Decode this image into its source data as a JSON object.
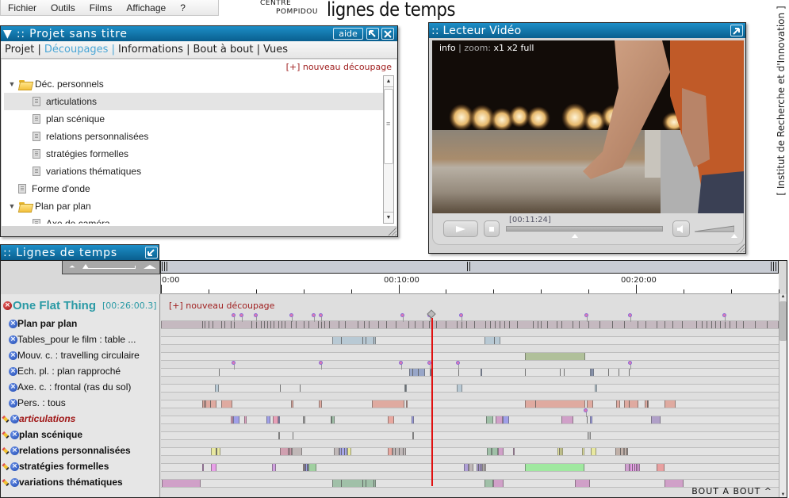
{
  "menu": [
    "Fichier",
    "Outils",
    "Films",
    "Affichage",
    "?"
  ],
  "logo": {
    "centre": "CENTRE",
    "pompidou": "POMPIDOU",
    "title": "lignes de temps"
  },
  "side_credit": "[ Institut de Recherche et d'Innovation ]",
  "project_panel": {
    "title": "▼ :: Projet sans titre",
    "help_label": "aide",
    "tabs": [
      {
        "label": "Projet |",
        "active": false
      },
      {
        "label": "Découpages |",
        "active": true
      },
      {
        "label": "Informations |",
        "active": false
      },
      {
        "label": "Bout à bout |",
        "active": false
      },
      {
        "label": "Vues",
        "active": false
      }
    ],
    "new_cut_label": "[+] nouveau découpage",
    "tree": [
      {
        "label": "Déc. personnels",
        "type": "folder",
        "level": 0,
        "expanded": true
      },
      {
        "label": "articulations",
        "type": "doc",
        "level": 1,
        "selected": true
      },
      {
        "label": "plan scénique",
        "type": "doc",
        "level": 1
      },
      {
        "label": "relations personnalisées",
        "type": "doc",
        "level": 1
      },
      {
        "label": "stratégies formelles",
        "type": "doc",
        "level": 1
      },
      {
        "label": "variations thématiques",
        "type": "doc",
        "level": 1
      },
      {
        "label": "Forme d'onde",
        "type": "doc",
        "level": 0.5
      },
      {
        "label": "Plan par plan",
        "type": "folder",
        "level": 0,
        "expanded": true
      },
      {
        "label": "Axe de caméra",
        "type": "doc",
        "level": 1
      }
    ]
  },
  "video_panel": {
    "title": ":: Lecteur Vidéo",
    "overlay": {
      "info": "info",
      "sep": " | ",
      "zoom": "zoom: ",
      "x1": "x1",
      "x2": "x2",
      "full": "full"
    },
    "time": "[00:11:24]",
    "progress": 0.438,
    "volume": 0.95
  },
  "timeline": {
    "title": ":: Lignes de temps",
    "total_duration_s": 1560.3,
    "ruler_labels": [
      {
        "t": 0,
        "label": "0:00"
      },
      {
        "t": 600,
        "label": "00:10:00"
      },
      {
        "t": 1200,
        "label": "00:20:00"
      }
    ],
    "minor_tick_interval_s": 120,
    "cursor_s": 684,
    "film": {
      "name": "One Flat Thing",
      "duration": "[00:26:00.3]"
    },
    "new_cut_label": "[+] nouveau découpage",
    "bottom_label": "BOUT A BOUT ^",
    "tracks": [
      {
        "label": "Plan par plan",
        "style": "bold",
        "pencil": false,
        "segments": [
          [
            0,
            1560,
            "#c5b9c0"
          ]
        ],
        "cuts": [
          104,
          110,
          120,
          130,
          152,
          160,
          176,
          184,
          228,
          240,
          252,
          260,
          268,
          276,
          284,
          296,
          304,
          312,
          328,
          340,
          360,
          372,
          396,
          404,
          412,
          424,
          448,
          464,
          496,
          512,
          524,
          548,
          568,
          592,
          624,
          640,
          660,
          676,
          696,
          720,
          748,
          760,
          772,
          792,
          820,
          832,
          844,
          856,
          868,
          880,
          900,
          940,
          952,
          960,
          976,
          1000,
          1012,
          1040,
          1056,
          1080,
          1108,
          1140,
          1170,
          1204,
          1224,
          1252,
          1272,
          1292,
          1316,
          1352,
          1366,
          1378,
          1390,
          1400,
          1412,
          1424,
          1436,
          1452,
          1470,
          1500,
          1530
        ],
        "markers": [
          184,
          204,
          240,
          330,
          386,
          404,
          610,
          680,
          760,
          1076,
          1186,
          1424
        ]
      },
      {
        "label": "Tables_pour le film : table ...",
        "style": "normal",
        "pencil": false,
        "segments": [
          [
            432,
            542,
            "#b8c9d4"
          ],
          [
            818,
            858,
            "#b8c9d4"
          ]
        ],
        "cuts": [
          455,
          508,
          516,
          536,
          842
        ],
        "markers": []
      },
      {
        "label": "Mouv. c. : travelling circulaire",
        "style": "normal",
        "pencil": false,
        "segments": [
          [
            920,
            1072,
            "#b0c09a"
          ]
        ],
        "cuts": [],
        "markers": []
      },
      {
        "label": "Ech. pl. : plan rapproché",
        "style": "normal",
        "pencil": false,
        "segments": [
          [
            626,
            666,
            "#98a6c8"
          ],
          [
            678,
            684,
            "#98a6c8"
          ],
          [
            808,
            812,
            "#98a6c8"
          ],
          [
            1084,
            1094,
            "#98a6c8"
          ]
        ],
        "cuts": [
          146,
          634,
          648,
          752,
          920,
          1008,
          1018,
          1088,
          1130,
          1156,
          1182
        ],
        "markers": [
          184,
          404,
          606,
          680,
          752,
          1186
        ]
      },
      {
        "label": "Axe. c. : frontal (ras du sol)",
        "style": "normal",
        "pencil": false,
        "segments": [
          [
            136,
            146,
            "#b8c9d4"
          ],
          [
            614,
            620,
            "#b8c9d4"
          ],
          [
            748,
            762,
            "#b8c9d4"
          ],
          [
            1096,
            1102,
            "#b8c9d4"
          ]
        ],
        "cuts": [
          300,
          350,
          616
        ],
        "markers": []
      },
      {
        "label": "Pers. : tous",
        "style": "normal",
        "pencil": false,
        "segments": [
          [
            104,
            140,
            "#dfaaa0"
          ],
          [
            152,
            180,
            "#dfaaa0"
          ],
          [
            328,
            334,
            "#dfaaa0"
          ],
          [
            398,
            406,
            "#dfaaa0"
          ],
          [
            532,
            614,
            "#dfaaa0"
          ],
          [
            618,
            620,
            "#dfaaa0"
          ],
          [
            920,
            1072,
            "#dfaaa0"
          ],
          [
            1076,
            1092,
            "#dfaaa0"
          ],
          [
            1150,
            1160,
            "#dfaaa0"
          ],
          [
            1170,
            1206,
            "#dfaaa0"
          ],
          [
            1222,
            1232,
            "#dfaaa0"
          ],
          [
            1272,
            1300,
            "#dfaaa0"
          ]
        ],
        "cuts": [
          108,
          112,
          124,
          946,
          1182,
          1228
        ],
        "markers": []
      },
      {
        "label": "articulations",
        "style": "italic-red",
        "pencil": true,
        "segments": [
          [
            176,
            182,
            "#e0a0c0"
          ],
          [
            182,
            198,
            "#a0a0e8"
          ],
          [
            210,
            216,
            "#e0a0c0"
          ],
          [
            266,
            276,
            "#a0a0e8"
          ],
          [
            282,
            296,
            "#e8a0b8"
          ],
          [
            296,
            300,
            "#a0a0e8"
          ],
          [
            358,
            364,
            "#a8a8a8"
          ],
          [
            428,
            438,
            "#a0c0a8"
          ],
          [
            572,
            588,
            "#e8a8a0"
          ],
          [
            632,
            638,
            "#a0a0e8"
          ],
          [
            822,
            840,
            "#a0c0a8"
          ],
          [
            846,
            864,
            "#d0a0c8"
          ],
          [
            864,
            880,
            "#a0a0e8"
          ],
          [
            1012,
            1042,
            "#d0a0c8"
          ],
          [
            1084,
            1090,
            "#a0a0e8"
          ],
          [
            1238,
            1262,
            "#b0a0c8"
          ]
        ],
        "cuts": [
          430,
          1076
        ],
        "markers": [
          1074
        ]
      },
      {
        "label": "plan scénique",
        "style": "bold",
        "pencil": true,
        "segments": [
          [
            296,
            300,
            "#b8b8b8"
          ],
          [
            634,
            638,
            "#b8b8b8"
          ],
          [
            1078,
            1086,
            "#b8b8b8"
          ]
        ],
        "cuts": [
          332
        ],
        "markers": []
      },
      {
        "label": "relations personnalisées",
        "style": "bold",
        "pencil": true,
        "segments": [
          [
            126,
            150,
            "#e8e8a0"
          ],
          [
            300,
            330,
            "#d0a0b0"
          ],
          [
            330,
            356,
            "#c0b8b8"
          ],
          [
            436,
            450,
            "#c0b8b8"
          ],
          [
            450,
            470,
            "#a8a8e8"
          ],
          [
            470,
            480,
            "#e8e8a0"
          ],
          [
            572,
            584,
            "#e8a8a0"
          ],
          [
            584,
            618,
            "#c0b8b8"
          ],
          [
            824,
            836,
            "#a0c0a8"
          ],
          [
            836,
            852,
            "#a0c0a8"
          ],
          [
            852,
            866,
            "#d0a0c8"
          ],
          [
            890,
            892,
            "#d0a0c8"
          ],
          [
            1002,
            1016,
            "#e8e8a0"
          ],
          [
            1064,
            1070,
            "#e8e8a0"
          ],
          [
            1086,
            1100,
            "#e8e8a0"
          ],
          [
            1148,
            1170,
            "#c0b0a8"
          ],
          [
            1170,
            1180,
            "#c0b0a8"
          ]
        ],
        "cuts": [
          138,
          140,
          320,
          324,
          455,
          462,
          590,
          600,
          610,
          1006,
          1010,
          1160,
          1175
        ],
        "markers": []
      },
      {
        "label": "stratégies formelles",
        "style": "bold",
        "pencil": true,
        "segments": [
          [
            104,
            108,
            "#d090d8"
          ],
          [
            126,
            140,
            "#e8a0e8"
          ],
          [
            280,
            290,
            "#d0a0e0"
          ],
          [
            358,
            362,
            "#c0a8a0"
          ],
          [
            362,
            372,
            "#a0a0e8"
          ],
          [
            372,
            392,
            "#a0d0a0"
          ],
          [
            766,
            778,
            "#b0a0d8"
          ],
          [
            778,
            790,
            "#c0b8b8"
          ],
          [
            798,
            812,
            "#b0a0d8"
          ],
          [
            812,
            822,
            "#c0b8b8"
          ],
          [
            920,
            1070,
            "#a0e8a0"
          ],
          [
            1172,
            1184,
            "#d0a0d0"
          ],
          [
            1184,
            1210,
            "#e8a0e8"
          ],
          [
            1252,
            1272,
            "#e8a0a0"
          ]
        ],
        "cuts": [
          364,
          368,
          802,
          806,
          816,
          1190,
          1196,
          1200,
          1204
        ],
        "markers": []
      },
      {
        "label": "variations thématiques",
        "style": "bold",
        "pencil": true,
        "segments": [
          [
            2,
            100,
            "#d0a0c8"
          ],
          [
            432,
            542,
            "#a0c0a8"
          ],
          [
            818,
            840,
            "#a0c0a8"
          ],
          [
            840,
            866,
            "#d0a0c8"
          ],
          [
            1046,
            1084,
            "#d0a0c8"
          ],
          [
            1272,
            1320,
            "#d0a0c8"
          ]
        ],
        "cuts": [
          455,
          508,
          516,
          536
        ],
        "markers": []
      }
    ]
  }
}
